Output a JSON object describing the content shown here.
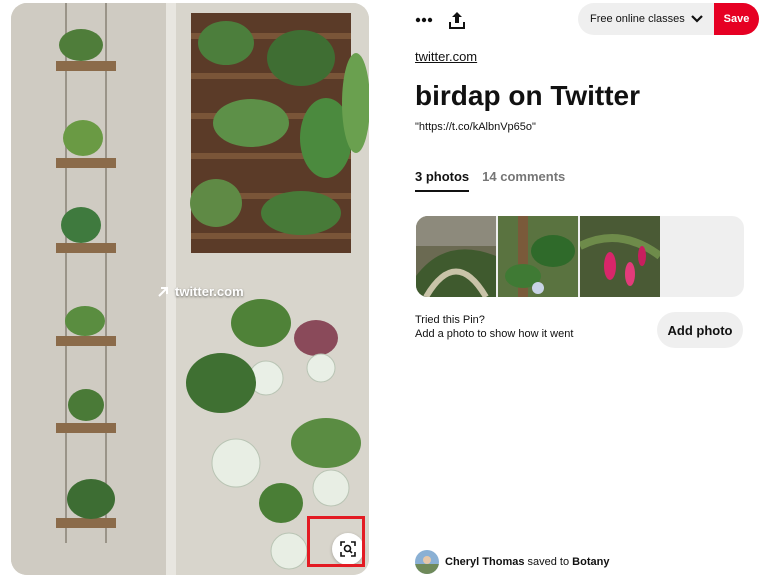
{
  "pin_image": {
    "overlay_link_text": "twitter.com",
    "overlay_icon": "arrow-up-right-icon",
    "lens_icon": "visual-search-icon"
  },
  "toolbar": {
    "more_icon": "more-dots-icon",
    "share_icon": "share-upload-icon",
    "board_select_value": "Free online classes",
    "board_select_icon": "chevron-down-icon",
    "save_label": "Save",
    "save_color": "#e60023"
  },
  "pin": {
    "source_link": "twitter.com",
    "title": "birdap on Twitter",
    "description": "\"https://t.co/kAlbnVp65o\""
  },
  "tabs": [
    {
      "label": "3 photos",
      "active": true
    },
    {
      "label": "14 comments",
      "active": false
    }
  ],
  "tried": {
    "title": "Tried this Pin?",
    "subtitle": "Add a photo to show how it went",
    "button_label": "Add photo"
  },
  "saved": {
    "user": "Cheryl Thomas",
    "action": " saved to ",
    "board": "Botany"
  },
  "colors": {
    "highlight_box": "#e31b23",
    "inactive_tab": "#767676",
    "pill_bg": "#efefef"
  }
}
